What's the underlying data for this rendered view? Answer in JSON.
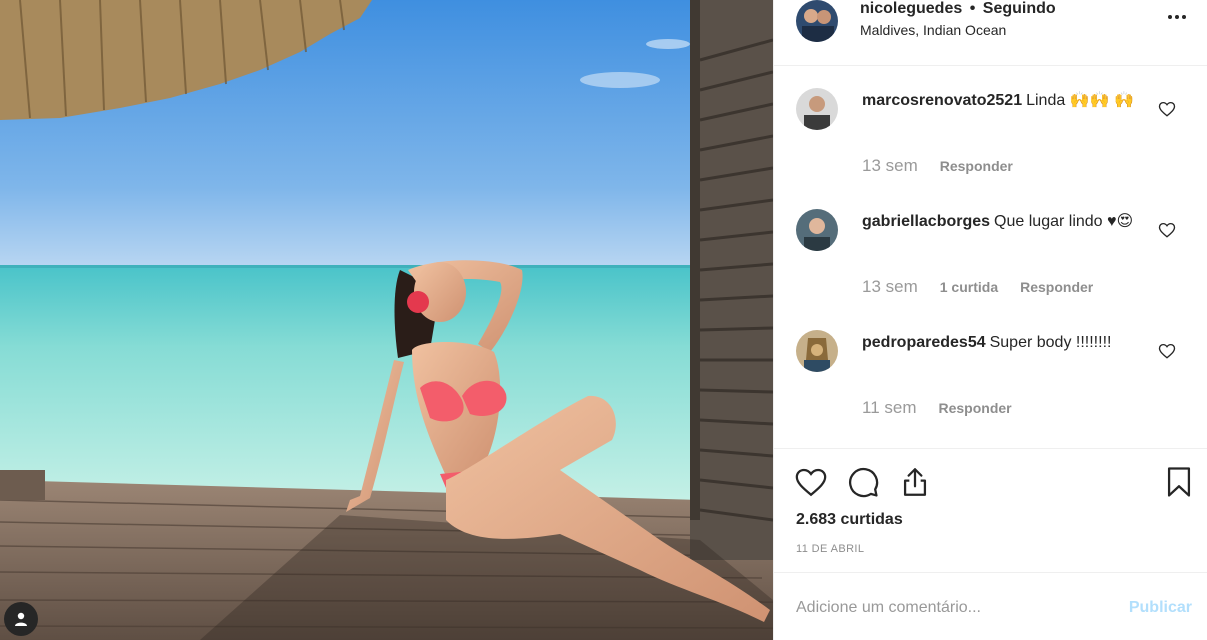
{
  "post": {
    "username": "nicoleguedes",
    "follow_status": "Seguindo",
    "separator": "•",
    "location": "Maldives, Indian Ocean",
    "likes": "2.683 curtidas",
    "date": "11 DE ABRIL"
  },
  "comments": [
    {
      "username": "marcosrenovato2521",
      "text": "Linda 🙌🙌 🙌",
      "time": "13 sem",
      "likes_label": "",
      "reply_label": "Responder"
    },
    {
      "username": "gabriellacborges",
      "text": "Que lugar lindo ♥😍",
      "time": "13 sem",
      "likes_label": "1 curtida",
      "reply_label": "Responder"
    },
    {
      "username": "pedroparedes54",
      "text": "Super body !!!!!!!!",
      "time": "11 sem",
      "likes_label": "",
      "reply_label": "Responder"
    }
  ],
  "add_comment": {
    "placeholder": "Adicione um comentário...",
    "publish_label": "Publicar"
  },
  "icons": {
    "more": "more-options-icon",
    "comment_like": "heart-outline-icon",
    "like": "heart-icon",
    "comment": "comment-bubble-icon",
    "share": "share-upload-icon",
    "save": "bookmark-icon",
    "user_tag": "user-tag-icon"
  },
  "colors": {
    "text": "#262626",
    "secondary": "#8e8e8e",
    "link_disabled": "#b2dffc",
    "divider": "#efefef"
  }
}
